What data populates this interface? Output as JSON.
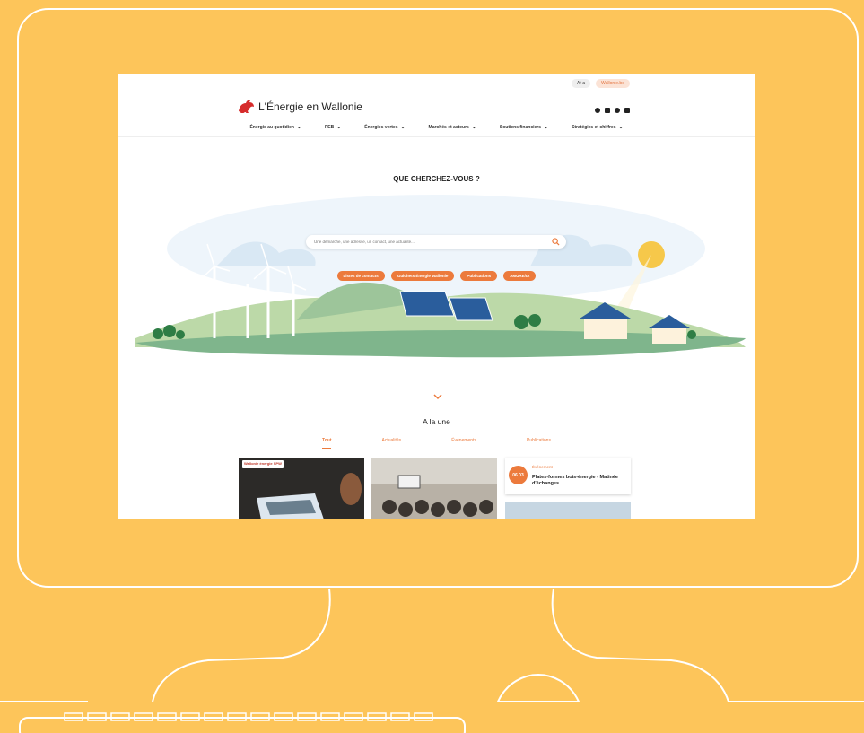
{
  "colors": {
    "background": "#fdc55a",
    "accent": "#ec7a3c",
    "outline": "#ffffff"
  },
  "topbar": {
    "text_size": "A+a",
    "site_link": "Wallonie.be"
  },
  "header": {
    "site_title": "L'Énergie en Wallonie"
  },
  "nav": {
    "items": [
      "Énergie au quotidien",
      "PEB",
      "Énergies vertes",
      "Marchés et acteurs",
      "Soutiens financiers",
      "Stratégies et chiffres"
    ]
  },
  "hero": {
    "title": "QUE CHERCHEZ-VOUS ?",
    "search_placeholder": "Une démarche, une adresse, un contact, une actualité...",
    "chips": [
      "Listes de contacts",
      "Guichets Énergie Wallonie",
      "Publications",
      "AMURE/IA"
    ]
  },
  "featured": {
    "title": "A la une",
    "tabs": [
      "Tout",
      "Actualités",
      "Événements",
      "Publications"
    ],
    "card1_badge": "Wallonie énergie SPW",
    "event": {
      "date": "06.03",
      "category": "Événement",
      "title": "Plates-formes bois-énergie - Matinée d'échanges"
    }
  },
  "icons": [
    "instagram-icon",
    "facebook-icon",
    "youtube-icon",
    "linkedin-icon",
    "search-icon",
    "chevron-down-icon",
    "rooster-logo-icon"
  ]
}
